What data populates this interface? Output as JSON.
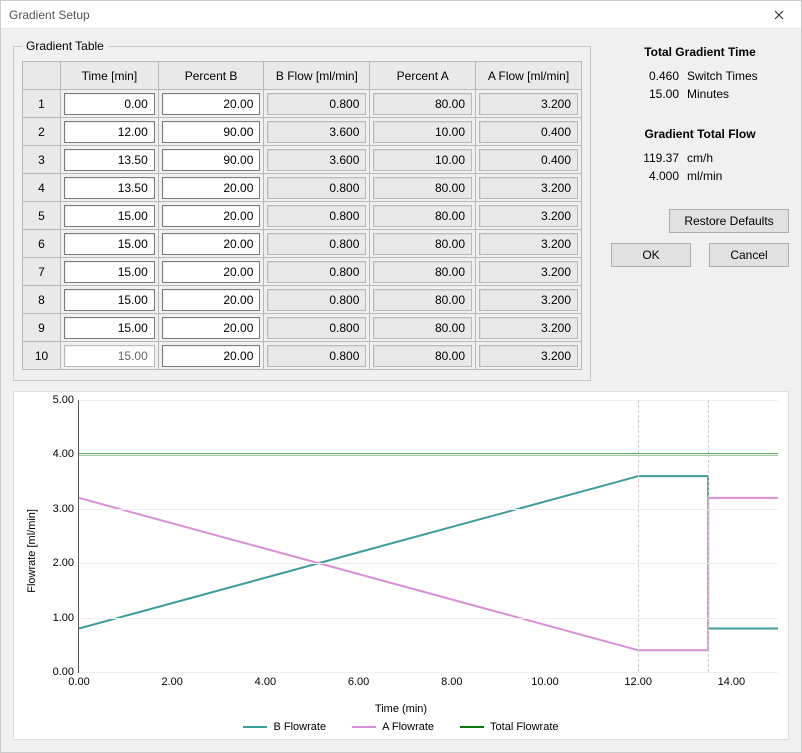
{
  "window": {
    "title": "Gradient Setup"
  },
  "fieldset_label": "Gradient Table",
  "columns": {
    "row": "",
    "time": "Time [min]",
    "pctB": "Percent B",
    "bflow": "B Flow [ml/min]",
    "pctA": "Percent A",
    "aflow": "A Flow [ml/min]"
  },
  "rows": [
    {
      "n": "1",
      "time": "0.00",
      "pctB": "20.00",
      "bflow": "0.800",
      "pctA": "80.00",
      "aflow": "3.200",
      "time_editable": true
    },
    {
      "n": "2",
      "time": "12.00",
      "pctB": "90.00",
      "bflow": "3.600",
      "pctA": "10.00",
      "aflow": "0.400",
      "time_editable": true
    },
    {
      "n": "3",
      "time": "13.50",
      "pctB": "90.00",
      "bflow": "3.600",
      "pctA": "10.00",
      "aflow": "0.400",
      "time_editable": true
    },
    {
      "n": "4",
      "time": "13.50",
      "pctB": "20.00",
      "bflow": "0.800",
      "pctA": "80.00",
      "aflow": "3.200",
      "time_editable": true
    },
    {
      "n": "5",
      "time": "15.00",
      "pctB": "20.00",
      "bflow": "0.800",
      "pctA": "80.00",
      "aflow": "3.200",
      "time_editable": true
    },
    {
      "n": "6",
      "time": "15.00",
      "pctB": "20.00",
      "bflow": "0.800",
      "pctA": "80.00",
      "aflow": "3.200",
      "time_editable": true
    },
    {
      "n": "7",
      "time": "15.00",
      "pctB": "20.00",
      "bflow": "0.800",
      "pctA": "80.00",
      "aflow": "3.200",
      "time_editable": true
    },
    {
      "n": "8",
      "time": "15.00",
      "pctB": "20.00",
      "bflow": "0.800",
      "pctA": "80.00",
      "aflow": "3.200",
      "time_editable": true
    },
    {
      "n": "9",
      "time": "15.00",
      "pctB": "20.00",
      "bflow": "0.800",
      "pctA": "80.00",
      "aflow": "3.200",
      "time_editable": true
    },
    {
      "n": "10",
      "time": "15.00",
      "pctB": "20.00",
      "bflow": "0.800",
      "pctA": "80.00",
      "aflow": "3.200",
      "time_editable": false
    }
  ],
  "summary": {
    "gradient_time_title": "Total Gradient Time",
    "switch_times_value": "0.460",
    "switch_times_label": "Switch Times",
    "minutes_value": "15.00",
    "minutes_label": "Minutes",
    "total_flow_title": "Gradient Total Flow",
    "cmh_value": "119.37",
    "cmh_label": "cm/h",
    "mlmin_value": "4.000",
    "mlmin_label": "ml/min"
  },
  "buttons": {
    "restore": "Restore Defaults",
    "ok": "OK",
    "cancel": "Cancel"
  },
  "chart_data": {
    "type": "line",
    "xlabel": "Time (min)",
    "ylabel": "Flowrate [ml/min]",
    "x_ticks": [
      "0.00",
      "2.00",
      "4.00",
      "6.00",
      "8.00",
      "10.00",
      "12.00",
      "14.00"
    ],
    "y_ticks": [
      "0.00",
      "1.00",
      "2.00",
      "3.00",
      "4.00",
      "5.00"
    ],
    "xlim": [
      0,
      15
    ],
    "ylim": [
      0,
      5
    ],
    "vguides": [
      12.0,
      13.5
    ],
    "series": [
      {
        "name": "B Flowrate",
        "color": "#3f9c9c",
        "points": [
          [
            0,
            0.8
          ],
          [
            12,
            3.6
          ],
          [
            13.5,
            3.6
          ],
          [
            13.5,
            0.8
          ],
          [
            15,
            0.8
          ]
        ]
      },
      {
        "name": "A Flowrate",
        "color": "#d88fd8",
        "points": [
          [
            0,
            3.2
          ],
          [
            12,
            0.4
          ],
          [
            13.5,
            0.4
          ],
          [
            13.5,
            3.2
          ],
          [
            15,
            3.2
          ]
        ]
      },
      {
        "name": "Total Flowrate",
        "color": "#0a7a0a",
        "points": [
          [
            0,
            4.0
          ],
          [
            15,
            4.0
          ]
        ]
      }
    ],
    "legend": [
      "B Flowrate",
      "A Flowrate",
      "Total Flowrate"
    ]
  }
}
